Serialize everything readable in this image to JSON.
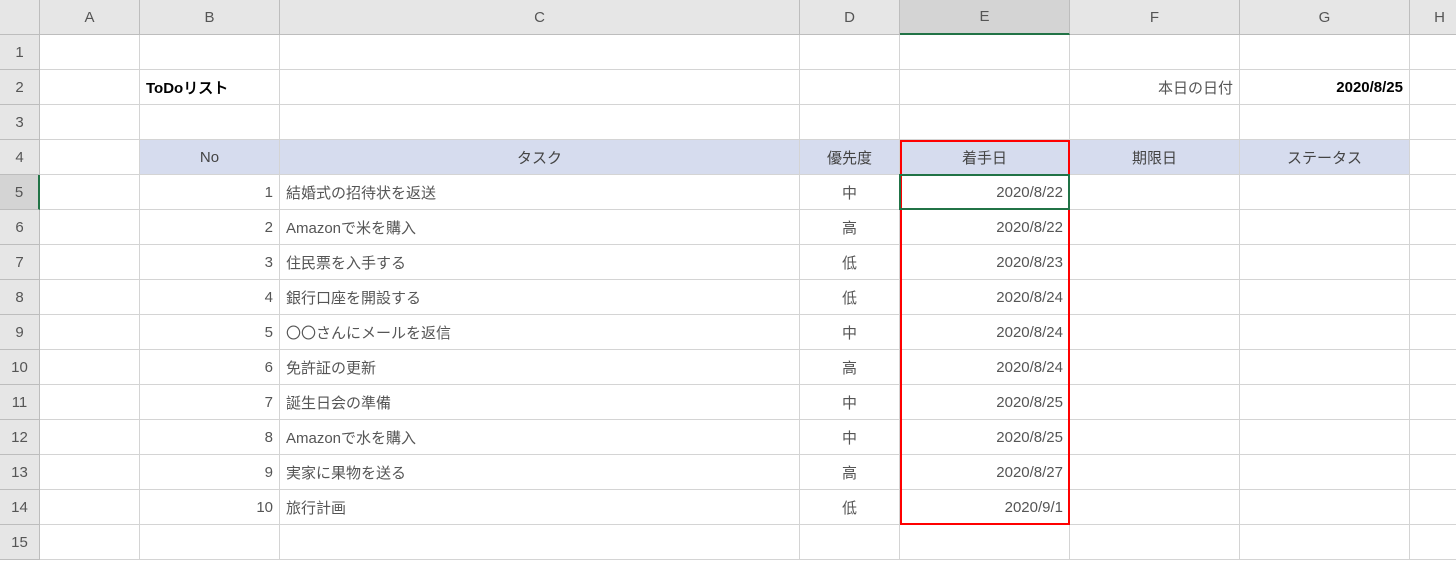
{
  "col_headers": [
    "A",
    "B",
    "C",
    "D",
    "E",
    "F",
    "G",
    "H"
  ],
  "row_headers": [
    "1",
    "2",
    "3",
    "4",
    "5",
    "6",
    "7",
    "8",
    "9",
    "10",
    "11",
    "12",
    "13",
    "14",
    "15"
  ],
  "active_col": "E",
  "active_row": "5",
  "title": "ToDoリスト",
  "today_label": "本日の日付",
  "today_value": "2020/8/25",
  "table_headers": {
    "no": "No",
    "task": "タスク",
    "priority": "優先度",
    "start": "着手日",
    "due": "期限日",
    "status": "ステータス"
  },
  "rows": [
    {
      "no": "1",
      "task": "結婚式の招待状を返送",
      "priority": "中",
      "start": "2020/8/22",
      "due": "",
      "status": ""
    },
    {
      "no": "2",
      "task": "Amazonで米を購入",
      "priority": "高",
      "start": "2020/8/22",
      "due": "",
      "status": ""
    },
    {
      "no": "3",
      "task": "住民票を入手する",
      "priority": "低",
      "start": "2020/8/23",
      "due": "",
      "status": ""
    },
    {
      "no": "4",
      "task": "銀行口座を開設する",
      "priority": "低",
      "start": "2020/8/24",
      "due": "",
      "status": ""
    },
    {
      "no": "5",
      "task": "〇〇さんにメールを返信",
      "priority": "中",
      "start": "2020/8/24",
      "due": "",
      "status": ""
    },
    {
      "no": "6",
      "task": "免許証の更新",
      "priority": "高",
      "start": "2020/8/24",
      "due": "",
      "status": ""
    },
    {
      "no": "7",
      "task": "誕生日会の準備",
      "priority": "中",
      "start": "2020/8/25",
      "due": "",
      "status": ""
    },
    {
      "no": "8",
      "task": "Amazonで水を購入",
      "priority": "中",
      "start": "2020/8/25",
      "due": "",
      "status": ""
    },
    {
      "no": "9",
      "task": "実家に果物を送る",
      "priority": "高",
      "start": "2020/8/27",
      "due": "",
      "status": ""
    },
    {
      "no": "10",
      "task": "旅行計画",
      "priority": "低",
      "start": "2020/9/1",
      "due": "",
      "status": ""
    }
  ],
  "selection": {
    "col": "E",
    "row": 5
  },
  "red_highlight": {
    "col": "E",
    "row_start": 4,
    "row_end": 14
  }
}
